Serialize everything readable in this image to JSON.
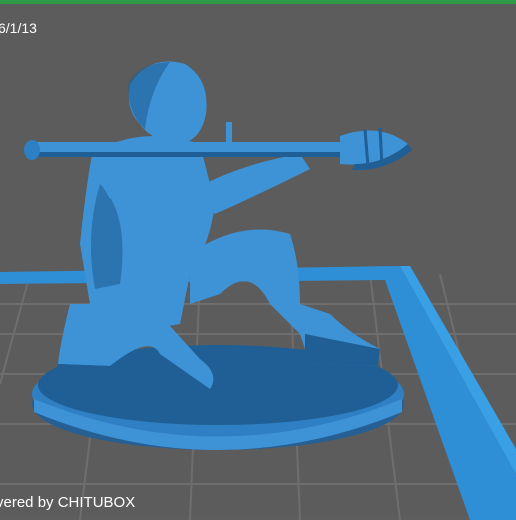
{
  "viewport": {
    "date_text": "6/1/13",
    "watermark_text": "vered by CHITUBOX"
  },
  "colors": {
    "background": "#5c5c5c",
    "grid_line": "#6e6e6e",
    "platform_edge": "#2f8fd6",
    "model": "#3d93d6",
    "model_shadow": "#1f5f95",
    "base": "#2f7fc4",
    "frame_border": "#2f9a45"
  },
  "scene": {
    "model_name": "kneeling soldier with rocket launcher",
    "icons": [
      "grid-floor",
      "build-plate-edge",
      "model-base",
      "figure-model"
    ]
  }
}
